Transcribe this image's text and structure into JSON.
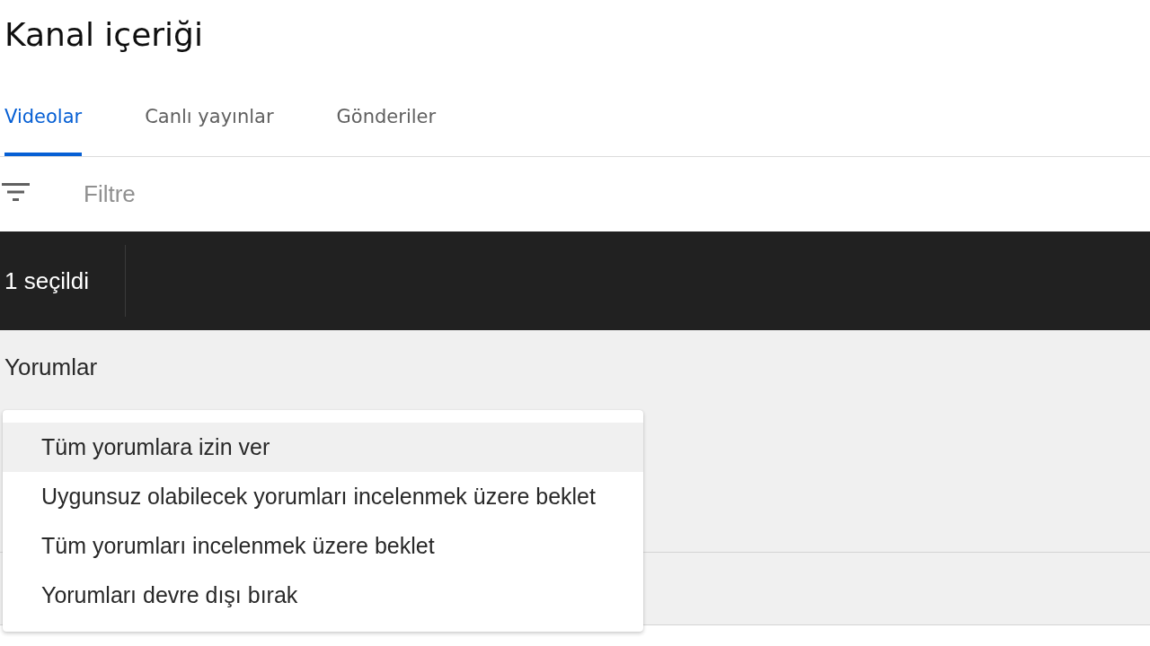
{
  "page": {
    "title": "Kanal içeriği"
  },
  "tabs": [
    {
      "label": "Videolar",
      "selected": true
    },
    {
      "label": "Canlı yayınlar",
      "selected": false
    },
    {
      "label": "Gönderiler",
      "selected": false
    }
  ],
  "filter": {
    "placeholder": "Filtre"
  },
  "selection_bar": {
    "count_text": "1 seçildi"
  },
  "edit_panel": {
    "label": "Yorumlar"
  },
  "comments_menu": {
    "options": [
      {
        "label": "Tüm yorumlara izin ver",
        "selected": true
      },
      {
        "label": "Uygunsuz olabilecek yorumları incelenmek üzere beklet",
        "selected": false
      },
      {
        "label": "Tüm yorumları incelenmek üzere beklet",
        "selected": false
      },
      {
        "label": "Yorumları devre dışı bırak",
        "selected": false
      }
    ]
  }
}
